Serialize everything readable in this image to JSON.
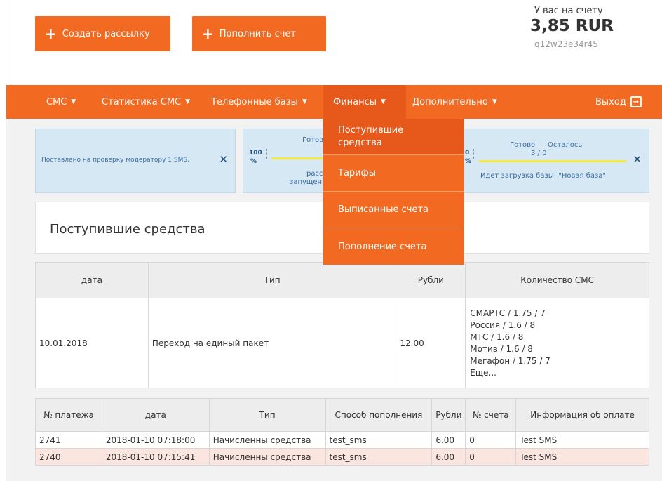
{
  "buttons": {
    "create_mailing": "Создать рассылку",
    "top_up": "Пополнить счет"
  },
  "balance": {
    "label": "У вас на счету",
    "amount": "3,85 RUR",
    "login": "q12w23e34r45"
  },
  "nav": {
    "items": [
      {
        "label": "СМС"
      },
      {
        "label": "Статистика СМС"
      },
      {
        "label": "Телефонные базы"
      },
      {
        "label": "Финансы"
      },
      {
        "label": "Дополнительно"
      }
    ],
    "exit": "Выход"
  },
  "finance_menu": {
    "items": [
      {
        "label_line1": "Поступившие",
        "label_line2": "средства"
      },
      {
        "label": "Тарифы"
      },
      {
        "label": "Выписанные счета"
      },
      {
        "label": "Пополнение счета"
      }
    ]
  },
  "notifications": {
    "n1": {
      "text": "Поставлено на проверку модератору 1 SMS."
    },
    "n2": {
      "pct": "100",
      "pct_unit": "%",
      "ready": "Готов",
      "line1": "расс",
      "line2": "запущен"
    },
    "n3": {
      "pct_fragment": "0",
      "pct_unit": "%",
      "ready": "Готово",
      "remaining": "Осталось",
      "counts": "3 / 0",
      "text": "Идет загрузка базы: \"Новая база\""
    }
  },
  "page_title": "Поступившие средства",
  "summary_table": {
    "headers": [
      "дата",
      "Тип",
      "Рубли",
      "Количество СМС"
    ],
    "row": {
      "date": "10.01.2018",
      "type": "Переход на единый пакет",
      "rubles": "12.00",
      "operators": [
        "СМАРТС / 1.75 / 7",
        "Россия / 1.6 / 8",
        "МТС / 1.6 / 8",
        "Мотив / 1.6 / 8",
        "Мегафон / 1.75 / 7",
        "Еще..."
      ]
    }
  },
  "payments_table": {
    "headers": [
      "№ платежа",
      "дата",
      "Тип",
      "Способ пополнения",
      "Рубли",
      "№ счета",
      "Информация об оплате"
    ],
    "rows": [
      [
        "2741",
        "2018-01-10 07:18:00",
        "Начисленны средства",
        "test_sms",
        "6.00",
        "0",
        "Test SMS"
      ],
      [
        "2740",
        "2018-01-10 07:15:41",
        "Начисленны средства",
        "test_sms",
        "6.00",
        "0",
        "Test SMS"
      ]
    ]
  },
  "colors": {
    "accent": "#f26a21",
    "accent_dark": "#e6591a",
    "info_bg": "#d6e8f3",
    "row_highlight": "#fbe5df"
  }
}
